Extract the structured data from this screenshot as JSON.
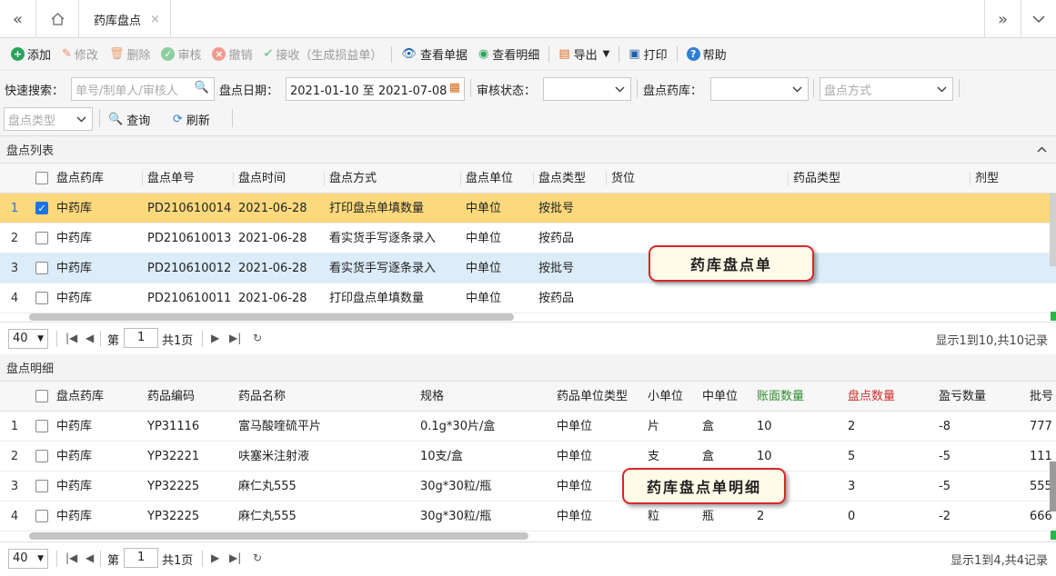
{
  "tabbar": {
    "collapse_icon": "double-chevron-left",
    "home_icon": "home",
    "tab_label": "药库盘点",
    "tab_close": "×",
    "more_icon": "double-chevron-right",
    "dropdown_icon": "chevron-down"
  },
  "toolbar": {
    "add": "添加",
    "edit": "修改",
    "delete": "删除",
    "audit": "审核",
    "cancel": "撤销",
    "receive": "接收（生成损益单）",
    "view_doc": "查看单据",
    "view_detail": "查看明细",
    "export": "导出",
    "print": "打印",
    "help": "帮助"
  },
  "search": {
    "quick_label": "快速搜索：",
    "quick_placeholder": "单号/制单人/审核人",
    "date_label": "盘点日期：",
    "date_value": "2021-01-10 至 2021-07-08",
    "status_label": "审核状态：",
    "status_value": "",
    "store_label": "盘点药库：",
    "store_value": "",
    "method_placeholder": "盘点方式",
    "type_placeholder": "盘点类型",
    "query": "查询",
    "refresh": "刷新"
  },
  "list": {
    "title": "盘点列表",
    "headers": [
      "盘点药库",
      "盘点单号",
      "盘点时间",
      "盘点方式",
      "盘点单位",
      "盘点类型",
      "货位",
      "药品类型",
      "剂型"
    ],
    "rows": [
      {
        "num": "1",
        "checked": true,
        "cells": [
          "中药库",
          "PD210610014",
          "2021-06-28",
          "打印盘点单填数量",
          "中单位",
          "按批号",
          "",
          "",
          ""
        ]
      },
      {
        "num": "2",
        "checked": false,
        "cells": [
          "中药库",
          "PD210610013",
          "2021-06-28",
          "看实货手写逐条录入",
          "中单位",
          "按药品",
          "",
          "",
          ""
        ]
      },
      {
        "num": "3",
        "checked": false,
        "cells": [
          "中药库",
          "PD210610012",
          "2021-06-28",
          "看实货手写逐条录入",
          "中单位",
          "按批号",
          "",
          "",
          ""
        ]
      },
      {
        "num": "4",
        "checked": false,
        "cells": [
          "中药库",
          "PD210610011",
          "2021-06-28",
          "打印盘点单填数量",
          "中单位",
          "按药品",
          "",
          "",
          ""
        ]
      }
    ],
    "pager": {
      "page_size": "40",
      "page_prefix": "第",
      "page": "1",
      "page_suffix": "共1页",
      "summary": "显示1到10,共10记录"
    },
    "callout": "药库盘点单"
  },
  "detail": {
    "title": "盘点明细",
    "headers": [
      "盘点药库",
      "药品编码",
      "药品名称",
      "规格",
      "药品单位类型",
      "小单位",
      "中单位",
      "账面数量",
      "盘点数量",
      "盈亏数量",
      "批号"
    ],
    "header_colors": {
      "book_qty": "#2e8b2e",
      "count_qty": "#d12b2b"
    },
    "rows": [
      {
        "num": "1",
        "cells": [
          "中药库",
          "YP31116",
          "富马酸喹硫平片",
          "0.1g*30片/盒",
          "中单位",
          "片",
          "盒",
          "10",
          "2",
          "-8",
          "777"
        ]
      },
      {
        "num": "2",
        "cells": [
          "中药库",
          "YP32221",
          "呋塞米注射液",
          "10支/盒",
          "中单位",
          "支",
          "盒",
          "10",
          "5",
          "-5",
          "111"
        ]
      },
      {
        "num": "3",
        "cells": [
          "中药库",
          "YP32225",
          "麻仁丸555",
          "30g*30粒/瓶",
          "中单位",
          "",
          "",
          "",
          "3",
          "-5",
          "555"
        ]
      },
      {
        "num": "4",
        "cells": [
          "中药库",
          "YP32225",
          "麻仁丸555",
          "30g*30粒/瓶",
          "中单位",
          "粒",
          "瓶",
          "2",
          "0",
          "-2",
          "666"
        ]
      }
    ],
    "pager": {
      "page_size": "40",
      "page_prefix": "第",
      "page": "1",
      "page_suffix": "共1页",
      "summary": "显示1到4,共4记录"
    },
    "callout": "药库盘点单明细"
  },
  "colors": {
    "selected_row": "#fbd97c",
    "hover_row": "#dcecf9",
    "accent": "#1a73e8"
  }
}
